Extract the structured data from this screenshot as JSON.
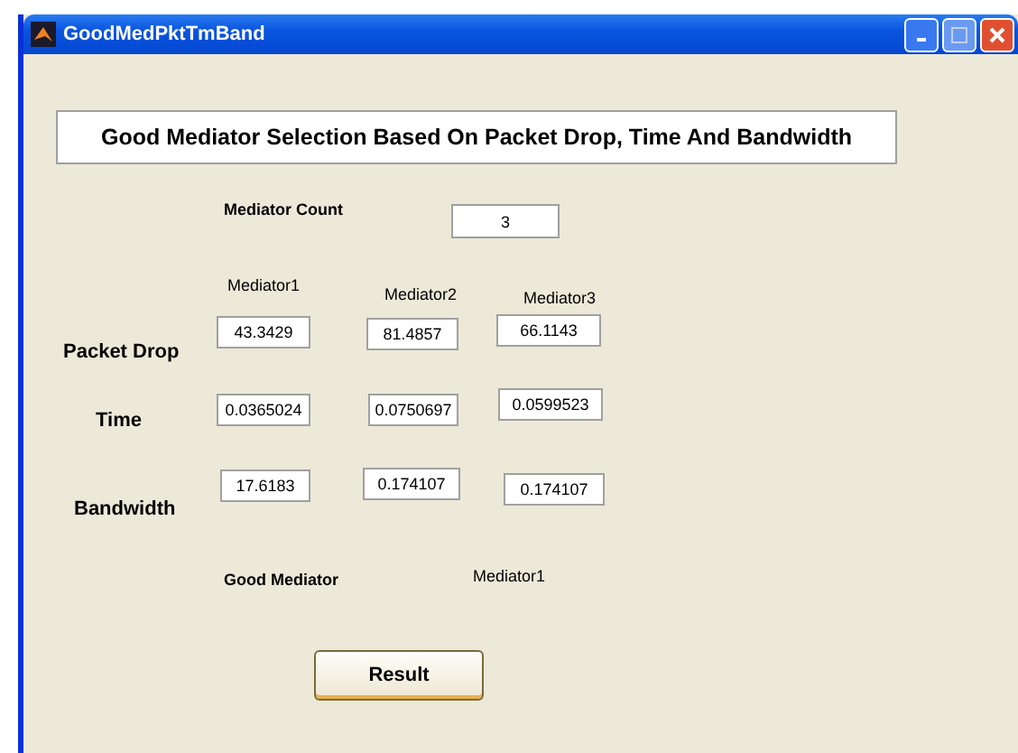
{
  "window": {
    "title": "GoodMedPktTmBand"
  },
  "heading": "Good Mediator Selection Based On Packet Drop, Time And Bandwidth",
  "mediator_count": {
    "label": "Mediator Count",
    "value": "3"
  },
  "columns": [
    "Mediator1",
    "Mediator2",
    "Mediator3"
  ],
  "rows": [
    {
      "label": "Packet Drop",
      "values": [
        "43.3429",
        "81.4857",
        "66.1143"
      ]
    },
    {
      "label": "Time",
      "values": [
        "0.0365024",
        "0.0750697",
        "0.0599523"
      ]
    },
    {
      "label": "Bandwidth",
      "values": [
        "17.6183",
        "0.174107",
        "0.174107"
      ]
    }
  ],
  "good_mediator": {
    "label": "Good Mediator",
    "value": "Mediator1"
  },
  "button": "Result"
}
